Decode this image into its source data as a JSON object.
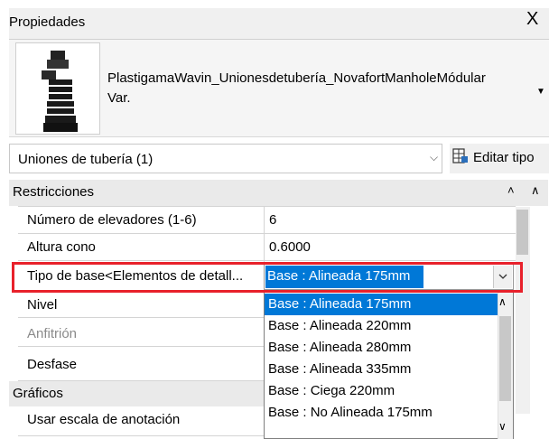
{
  "panel": {
    "title": "Propiedades",
    "close": "X"
  },
  "type": {
    "name_line1": "PlastigamaWavin_Unionesdetubería_NovafortManholeMódular",
    "name_line2": "Var."
  },
  "selector": {
    "label": "Uniones de tubería (1)",
    "edit_type": "Editar tipo"
  },
  "grid": {
    "cat_restricciones": "Restricciones",
    "rows": [
      {
        "name": "Número de elevadores (1-6)",
        "value": "6"
      },
      {
        "name": "Altura cono",
        "value": "0.6000"
      },
      {
        "name": "Tipo de base<Elementos de detall...",
        "value": "Base : Alineada 175mm"
      },
      {
        "name": "Nivel",
        "value": ""
      },
      {
        "name": "Anfitrión",
        "value": ""
      },
      {
        "name": "Desfase",
        "value": ""
      }
    ],
    "cat_graficos": "Gráficos",
    "row_graficos": {
      "name": "Usar escala de anotación",
      "value": ""
    }
  },
  "dropdown": {
    "selected": "Base : Alineada 175mm",
    "options": [
      "Base : Alineada 175mm",
      "Base : Alineada 220mm",
      "Base : Alineada 280mm",
      "Base : Alineada 335mm",
      "Base : Ciega 220mm",
      "Base : No Alineada 175mm"
    ]
  },
  "colors": {
    "selection": "#0078d7",
    "highlight_box": "#e8212b",
    "muted_text": "#8a8a8a"
  },
  "icons": {
    "close": "close-icon",
    "edit_type": "edit-type-icon",
    "chevron": "chevron-down-icon",
    "collapse": "double-chevron-up-icon"
  }
}
